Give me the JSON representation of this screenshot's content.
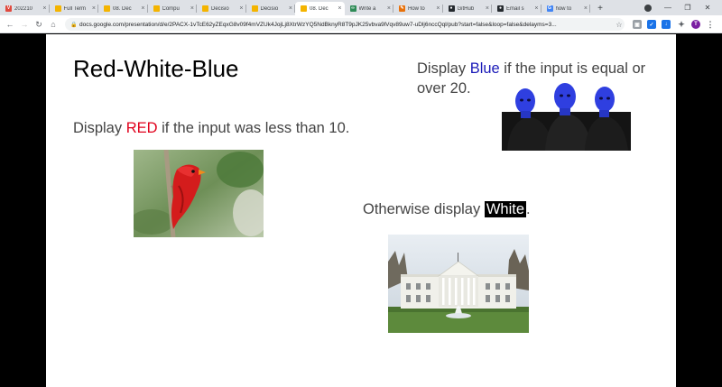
{
  "browser": {
    "tabs": [
      {
        "label": "202210",
        "icon": "v-icon",
        "color": "#e04a3f",
        "active": false
      },
      {
        "label": "Full Term",
        "icon": "slides-icon",
        "color": "#f4b400",
        "active": false
      },
      {
        "label": "08. Dec",
        "icon": "slides-icon",
        "color": "#f4b400",
        "active": false
      },
      {
        "label": "Compu",
        "icon": "slides-icon",
        "color": "#f4b400",
        "active": false
      },
      {
        "label": "Decisio",
        "icon": "slides-icon",
        "color": "#f4b400",
        "active": false
      },
      {
        "label": "Decisio",
        "icon": "slides-icon",
        "color": "#f4b400",
        "active": false
      },
      {
        "label": "08. Dec",
        "icon": "slides-icon",
        "color": "#f4b400",
        "active": true
      },
      {
        "label": "Write a",
        "icon": "link-icon",
        "color": "#2e8b57",
        "active": false
      },
      {
        "label": "How to",
        "icon": "pen-icon",
        "color": "#e8710a",
        "active": false
      },
      {
        "label": "GitHub",
        "icon": "github-icon",
        "color": "#24292e",
        "active": false
      },
      {
        "label": "Email s",
        "icon": "github-icon",
        "color": "#24292e",
        "active": false
      },
      {
        "label": "how to",
        "icon": "google-icon",
        "color": "#4285f4",
        "active": false
      }
    ],
    "url": "docs.google.com/presentation/d/e/2PACX-1vTcE62yZEqxG8v09f4mVZUk4JojLj8XtrWzYQ5NdBknyR8T9pJK25vbva9lVqv89uw7-uDlj6nccQql/pub?start=false&loop=false&delayms=3..."
  },
  "slide": {
    "title": "Red-White-Blue",
    "blue_text": {
      "before": "Display ",
      "highlight": "Blue",
      "after": " if the input is equal or over 20."
    },
    "red_text": {
      "before": "Display ",
      "highlight": "RED",
      "after": " if the input was less than 10."
    },
    "white_text": {
      "before": "Otherwise display ",
      "highlight": "White",
      "after": "."
    },
    "colors": {
      "red": "#e0001b",
      "blue": "#1a1ab8",
      "text": "#444444"
    }
  }
}
